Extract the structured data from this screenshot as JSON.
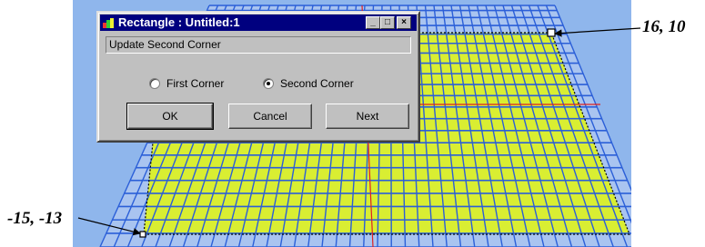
{
  "dialog": {
    "title": "Rectangle : Untitled:1",
    "status": "Update Second Corner",
    "options": [
      {
        "label": "First Corner",
        "selected": false
      },
      {
        "label": "Second Corner",
        "selected": true
      }
    ],
    "buttons": {
      "ok": "OK",
      "cancel": "Cancel",
      "next": "Next"
    },
    "titlebar_buttons": {
      "minimize": "_",
      "maximize": "□",
      "close": "×"
    }
  },
  "callouts": {
    "top_right": "16, 10",
    "bottom_left": "-15, -13"
  },
  "colors": {
    "grid_fill": "#d9ee32",
    "grid_line": "#2b5fd8",
    "background": "#8fb6ec",
    "axis_line": "#e02020"
  }
}
